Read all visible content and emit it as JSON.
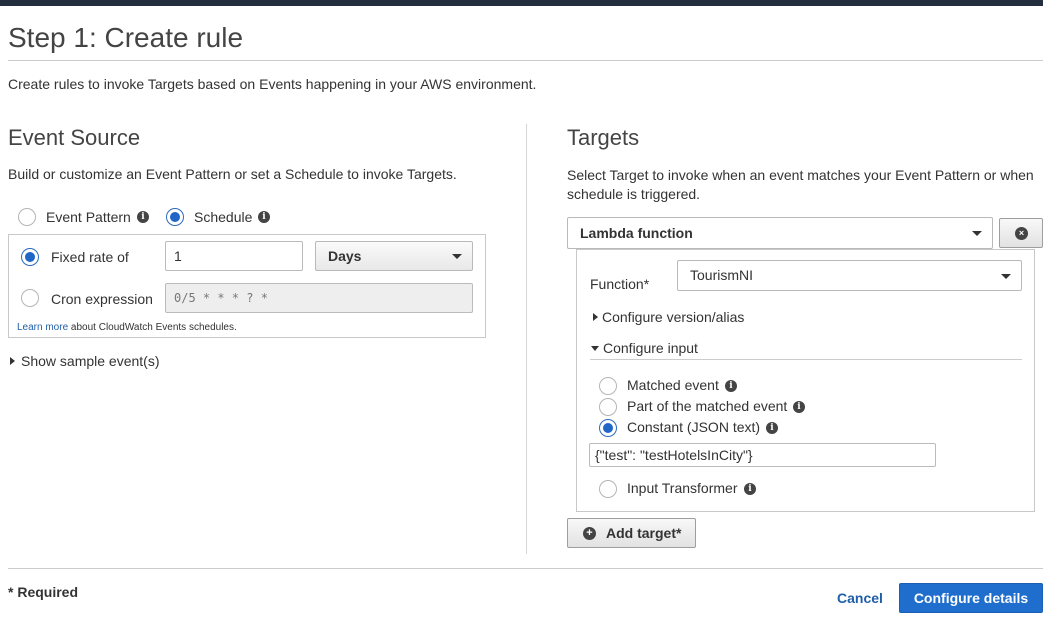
{
  "page": {
    "title": "Step 1: Create rule",
    "description": "Create rules to invoke Targets based on Events happening in your AWS environment."
  },
  "event_source": {
    "heading": "Event Source",
    "description": "Build or customize an Event Pattern or set a Schedule to invoke Targets.",
    "option_event_pattern": "Event Pattern",
    "option_schedule": "Schedule",
    "selected_option": "Schedule",
    "fixed_rate_label": "Fixed rate of",
    "fixed_rate_value": "1",
    "fixed_rate_unit": "Days",
    "cron_label": "Cron expression",
    "cron_value": "0/5 * * * ? *",
    "learn_more_link": "Learn more",
    "learn_more_text": " about CloudWatch Events schedules.",
    "show_sample": "Show sample event(s)"
  },
  "targets": {
    "heading": "Targets",
    "description": "Select Target to invoke when an event matches your Event Pattern or when schedule is triggered.",
    "target_type": "Lambda function",
    "function_label": "Function*",
    "function_value": "TourismNI",
    "configure_version": "Configure version/alias",
    "configure_input": "Configure input",
    "input_options": {
      "matched_event": "Matched event",
      "part_matched": "Part of the matched event",
      "constant_json": "Constant (JSON text)",
      "input_transformer": "Input Transformer"
    },
    "selected_input": "Constant (JSON text)",
    "constant_value": "{\"test\": \"testHotelsInCity\"}",
    "add_target": "Add target*"
  },
  "footer": {
    "required_note": "* Required",
    "cancel": "Cancel",
    "configure_details": "Configure details"
  },
  "colors": {
    "primary": "#1f6dcc",
    "link": "#1f5fa8",
    "topbar": "#232f3e"
  }
}
